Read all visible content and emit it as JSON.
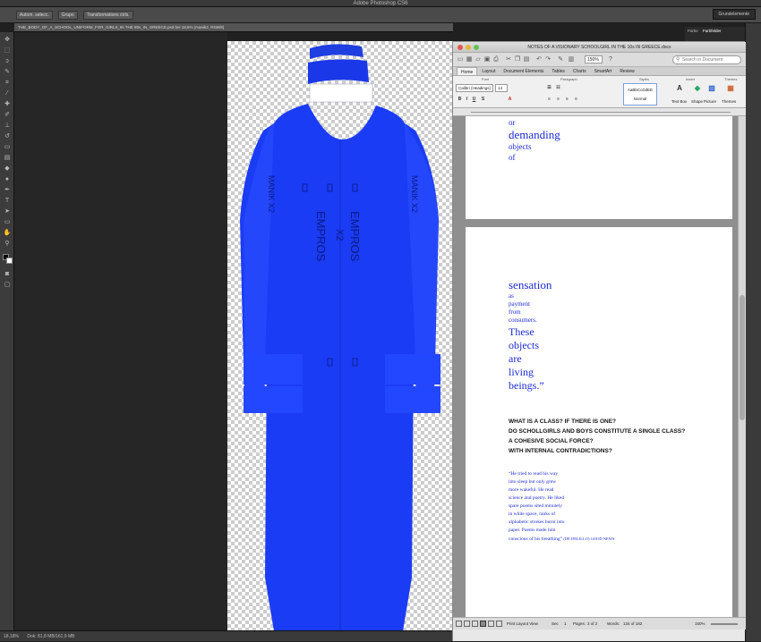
{
  "photoshop": {
    "app_title": "Adobe Photoshop CS6",
    "options": {
      "auto_select": "Autom. selecc.",
      "group": "Grupo",
      "transform_controls": "Transformations ctrls."
    },
    "workspace": "Grundelemente",
    "doc_tab": "THE_BODY_OF_A_SCHOOL_UNIFORM_FOR_GIRLS_IN THE 80s_IN_GREECE.psd bei 18,6% (manik2, RGB/8)",
    "status_zoom": "18,18%",
    "status_doc": "Dok: 81,8 MB/161,9 MB",
    "swatch_labels": [
      "Farbe",
      "Farbfelder"
    ],
    "uniform_texts": {
      "manik_left": "MANIK X2",
      "manik_right": "MANIK X2",
      "empros": "EMPROS",
      "x2": "X2",
      "empros_mirror": "EMPROS"
    }
  },
  "word": {
    "title": "NOTES OF A VISIONARY SCHOOLGIRL IN THE 10s IN GREECE.docx",
    "zoom": "150%",
    "search_placeholder": "Search in Document",
    "tabs": [
      "Home",
      "Layout",
      "Document Elements",
      "Tables",
      "Charts",
      "SmartArt",
      "Review"
    ],
    "ribbon": {
      "groups": [
        "Font",
        "Paragraph",
        "Styles",
        "Insert",
        "Themes"
      ],
      "font_name": "Calibri (Headings)",
      "font_size": "14",
      "style_preview": "AaBbCcDdEE",
      "style_name": "Normal",
      "insert_items": [
        "Text Box",
        "Shape",
        "Picture"
      ],
      "themes_label": "Themes"
    },
    "page1_lines": [
      "or",
      "demanding",
      "objects",
      "of"
    ],
    "page2": {
      "sensation_lines": [
        "sensation",
        "as",
        "payment",
        "from",
        "consumers.",
        "These",
        "objects",
        "are",
        "living",
        "beings.”"
      ],
      "questions": [
        "WHAT IS A CLASS? IF THERE IS ONE?",
        "DO SCHOLLGIRLS AND BOYS CONSTITUTE A SINGLE CLASS?",
        "A COHESIVE SOCIAL FORCE?",
        "WITH INTERNAL CONTRADICTIONS?"
      ],
      "quote_lines": [
        "“He tried to read his way",
        "into  sleep but only grew",
        "more wakeful. He read",
        "science and poetry.  He liked",
        "spare poems sited minutely",
        "in white space, ranks of",
        "alphabetic strokes burnt into",
        "paper. Poems made him",
        "conscious of his breathing”"
      ],
      "quote_source": "(DE DELILLO) GOOD NEWS"
    },
    "status": {
      "view": "Print Layout View",
      "sec_label": "Sec",
      "sec": "1",
      "pages_label": "Pages:",
      "pages": "2 of 2",
      "words_label": "Words:",
      "words": "134 of 182",
      "zoom": "150%"
    }
  }
}
